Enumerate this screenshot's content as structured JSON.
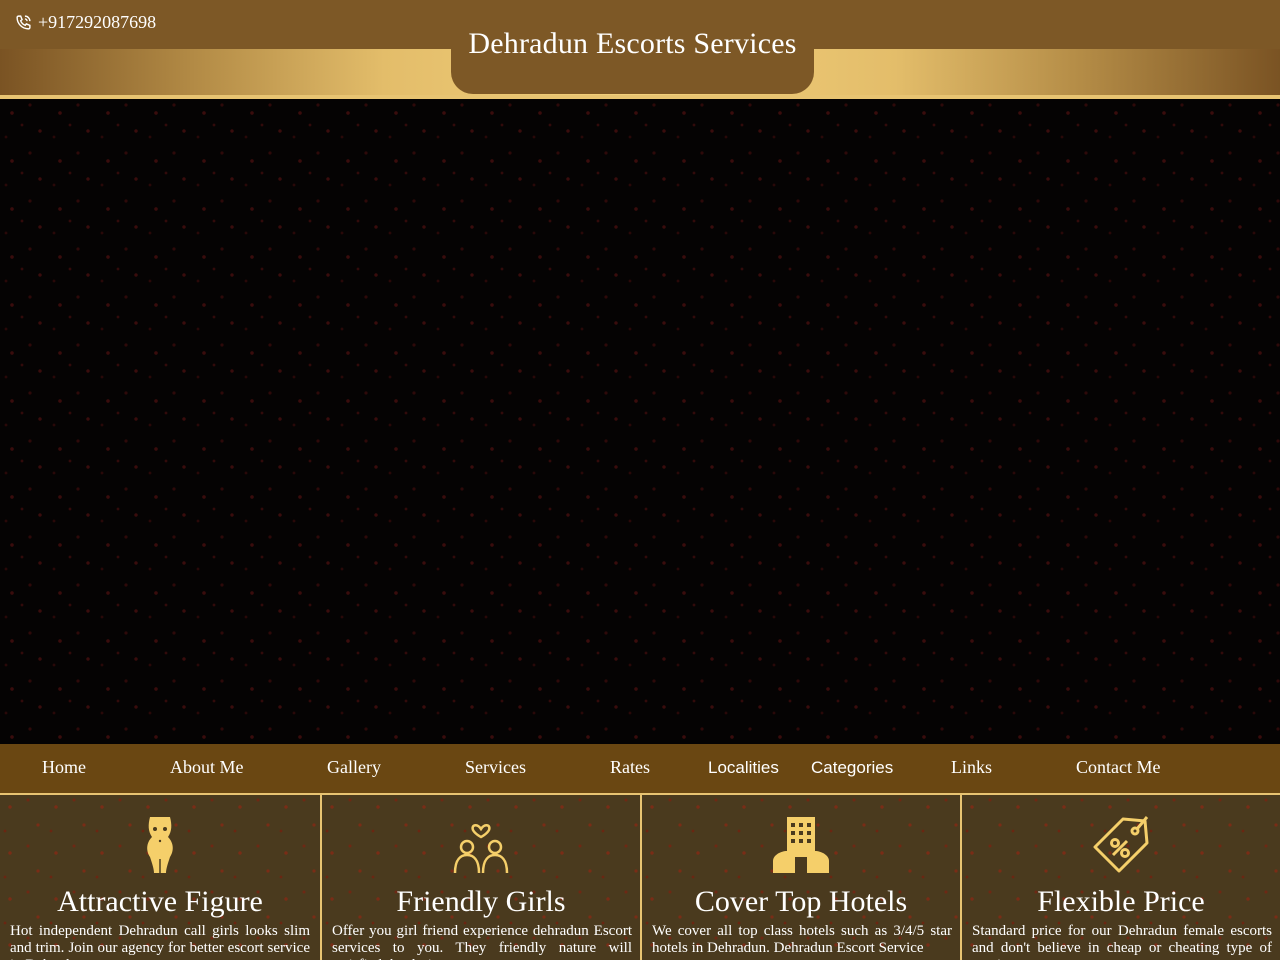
{
  "header": {
    "phone": "+917292087698",
    "title": "Dehradun Escorts Services"
  },
  "nav": {
    "items": [
      {
        "label": "Home"
      },
      {
        "label": "About Me"
      },
      {
        "label": "Gallery"
      },
      {
        "label": "Services"
      },
      {
        "label": "Rates"
      },
      {
        "label": "Localities"
      },
      {
        "label": "Categories"
      },
      {
        "label": "Links"
      },
      {
        "label": "Contact Me"
      }
    ]
  },
  "features": [
    {
      "icon": "figure-icon",
      "title": "Attractive Figure",
      "text": "Hot independent Dehradun call girls looks slim and trim. Join our agency for better escort service in Dehradun."
    },
    {
      "icon": "couple-heart-icon",
      "title": "Friendly Girls",
      "text": "Offer you girl friend experience dehradun Escort services to you. They friendly nature will satisfied the desire."
    },
    {
      "icon": "hotel-icon",
      "title": "Cover Top Hotels",
      "text": "We cover all top class hotels such as 3/4/5 star hotels in Dehradun. Dehradun Escort Service"
    },
    {
      "icon": "discount-tag-icon",
      "title": "Flexible Price",
      "text": "Standard price for our Dehradun female escorts and don't believe in cheap or cheating type of service."
    }
  ],
  "colors": {
    "header_brown": "#7d5826",
    "gold": "#e8c472",
    "nav_brown": "#6a4712",
    "card_bg": "#4a3a1e",
    "icon_gold": "#f5cf6a"
  }
}
